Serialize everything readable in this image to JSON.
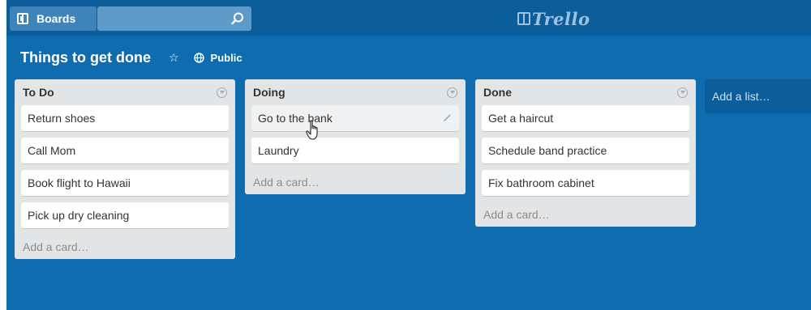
{
  "topbar": {
    "boards_label": "Boards",
    "search_value": "",
    "search_icon": "search-icon",
    "logo_text": "Trello"
  },
  "board": {
    "title": "Things to get done",
    "star_glyph": "☆",
    "visibility_label": "Public"
  },
  "lists": [
    {
      "title": "To Do",
      "cards": [
        "Return shoes",
        "Call Mom",
        "Book flight to Hawaii",
        "Pick up dry cleaning"
      ],
      "add_card_label": "Add a card…"
    },
    {
      "title": "Doing",
      "cards": [
        "Go to the bank",
        "Laundry"
      ],
      "add_card_label": "Add a card…"
    },
    {
      "title": "Done",
      "cards": [
        "Get a haircut",
        "Schedule band practice",
        "Fix bathroom cabinet"
      ],
      "add_card_label": "Add a card…"
    }
  ],
  "add_list_label": "Add a list…",
  "colors": {
    "board_bg": "#0f6cae",
    "header_bg": "#0c5e9a",
    "list_bg": "#e2e4e6",
    "card_bg": "#ffffff"
  },
  "icons": {
    "boards": "boards-icon",
    "star": "star-icon",
    "visibility": "globe-icon",
    "list_menu": "list-menu-icon",
    "edit": "pencil-icon",
    "cursor": "hand-cursor-icon"
  }
}
